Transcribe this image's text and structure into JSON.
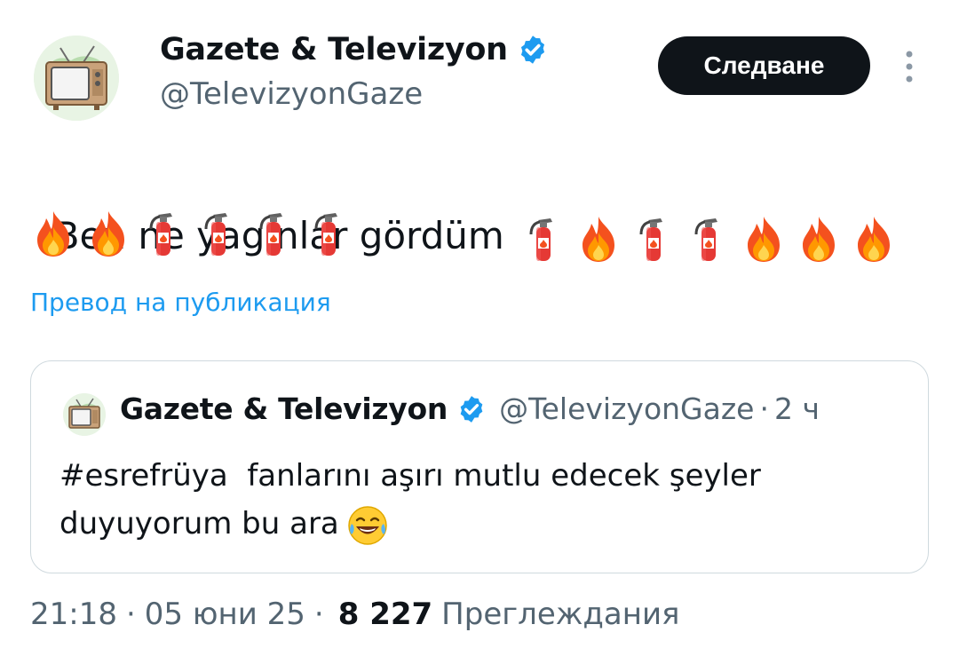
{
  "author": {
    "display_name": "Gazete & Televizyon",
    "handle": "@TelevizyonGaze",
    "avatar_icon": "retro-tv-icon",
    "verified": true
  },
  "follow_button": {
    "label": "Следване"
  },
  "more_menu": {
    "icon": "more-vertical-icon"
  },
  "post": {
    "text": "Ben ne yagınlar gördüm",
    "emoji_line1": [
      "fire-extinguisher",
      "fire",
      "fire-extinguisher",
      "fire-extinguisher",
      "fire",
      "fire",
      "fire"
    ],
    "emoji_line2": [
      "fire",
      "fire",
      "fire-extinguisher",
      "fire-extinguisher",
      "fire-extinguisher",
      "fire-extinguisher"
    ]
  },
  "translate_link": "Превод на публикация",
  "quoted_post": {
    "display_name": "Gazete & Televizyon",
    "handle": "@TelevizyonGaze",
    "separator": "·",
    "time": "2 ч",
    "text": "#esrefrüya  fanlarını aşırı mutlu edecek şeyler\nduyuyorum bu ara",
    "emoji": "face-with-tears-of-joy"
  },
  "meta": {
    "time": "21:18",
    "separator": "·",
    "date": "05 юни 25",
    "views_count": "8 227",
    "views_label": "Преглеждания"
  },
  "colors": {
    "accent": "#1d9bf0",
    "text": "#0f1419",
    "secondary": "#536471",
    "button_bg": "#0f1419",
    "border": "#cfd9de"
  }
}
